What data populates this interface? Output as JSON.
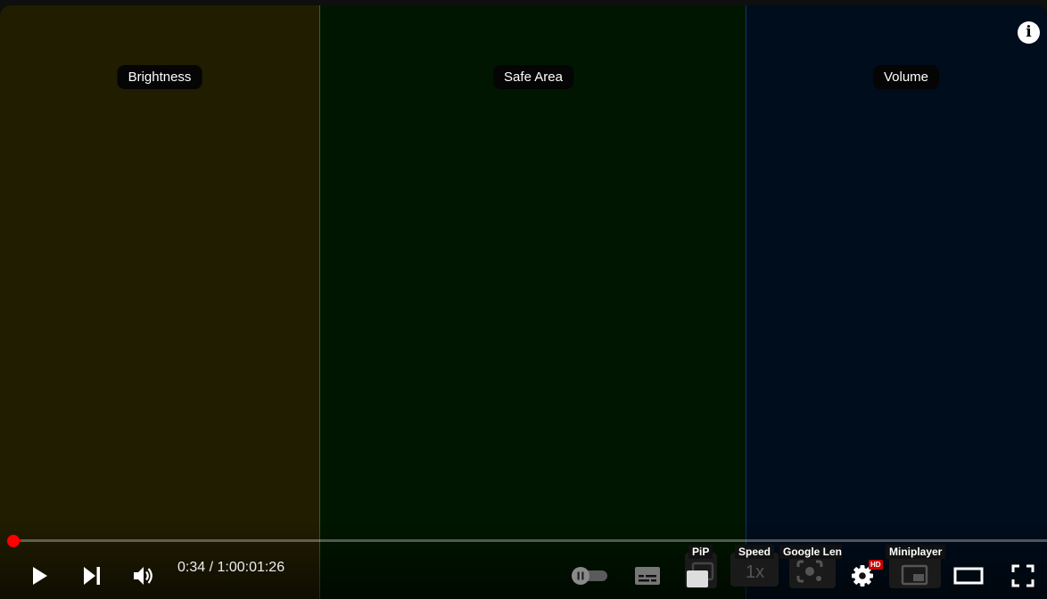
{
  "zones": {
    "brightness_label": "Brightness",
    "safe_area_label": "Safe Area",
    "volume_label": "Volume"
  },
  "info": {
    "glyph": "i"
  },
  "progress": {
    "played_fraction": 0.0094
  },
  "controls": {
    "time_display": "0:34 / 1:00:01:26",
    "pip_label": "PiP",
    "speed_label": "Speed",
    "speed_value": "1x",
    "lens_label": "Google Len",
    "miniplayer_label": "Miniplayer",
    "hd_badge": "HD"
  },
  "colors": {
    "brightness_zone": "#211d01",
    "safe_zone": "#001600",
    "volume_zone": "#000d1c",
    "progress": "#ff0000"
  }
}
